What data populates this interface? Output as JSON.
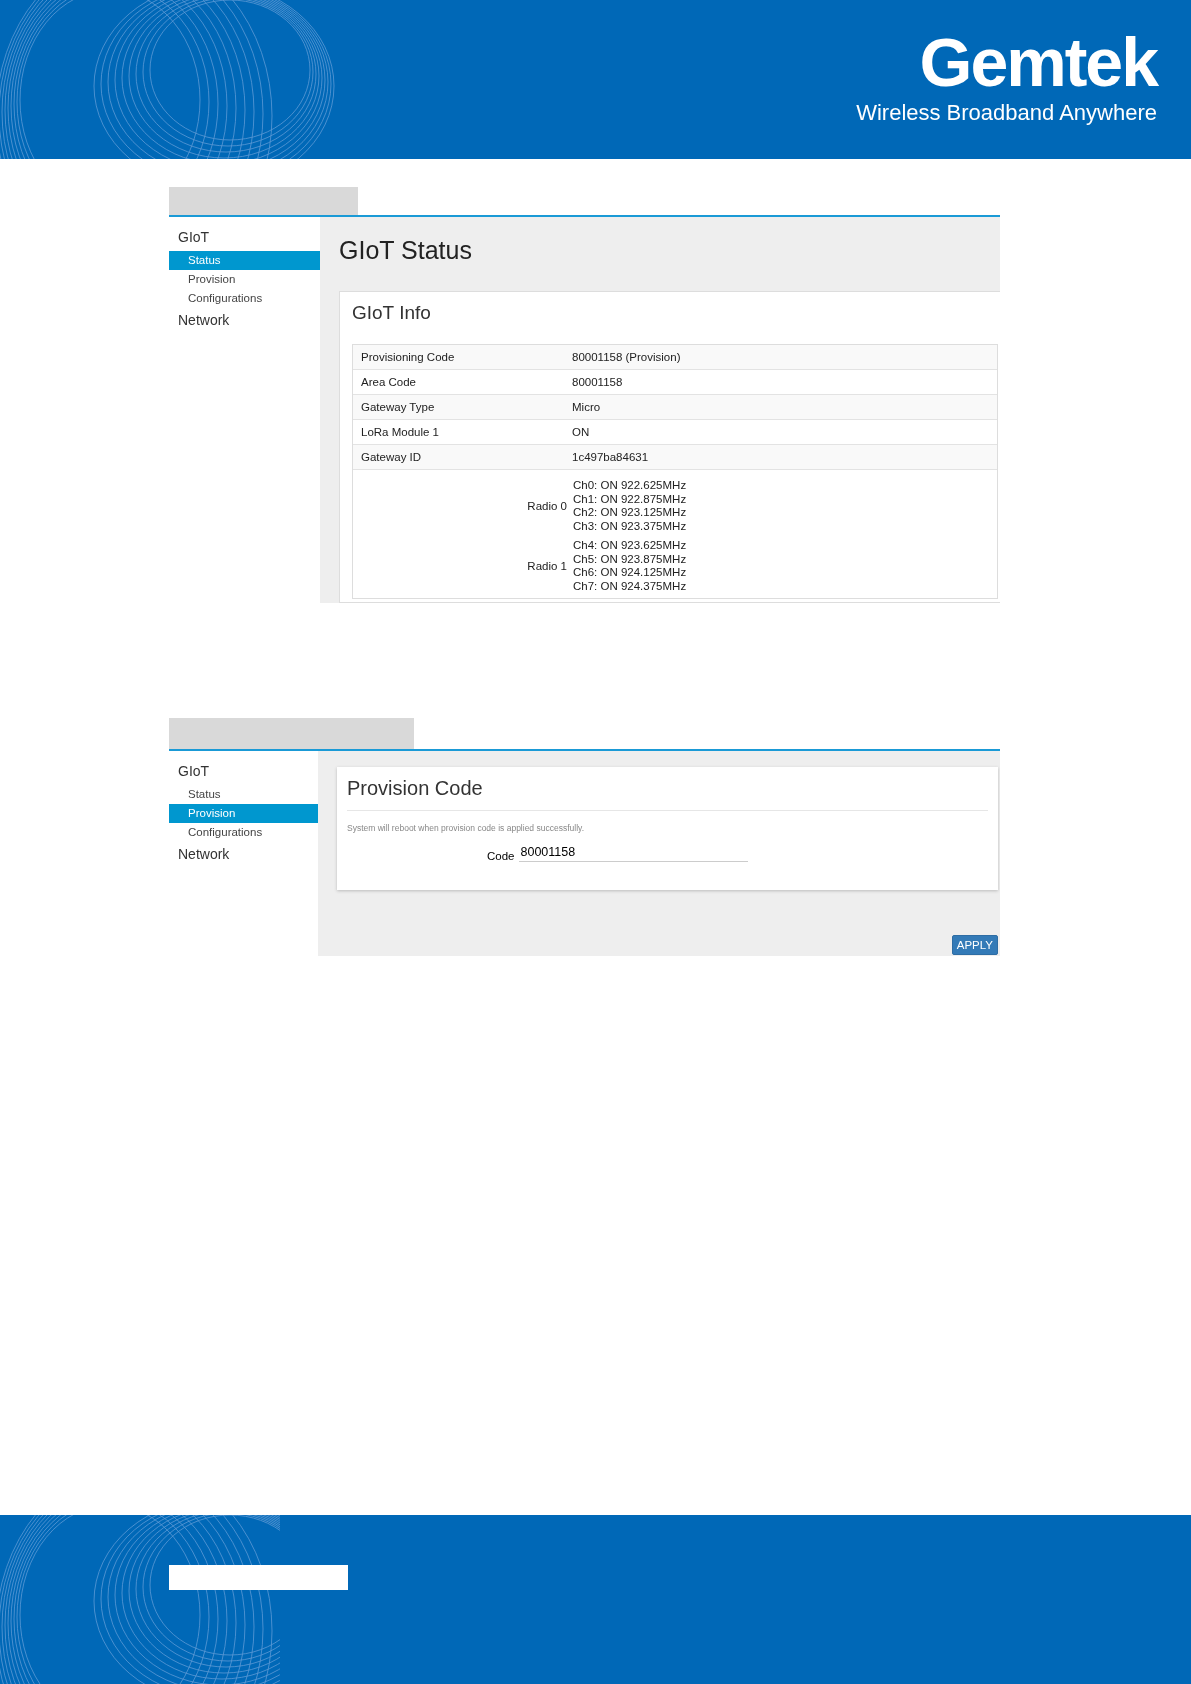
{
  "header": {
    "logo": "Gemtek",
    "tagline": "Wireless Broadband Anywhere"
  },
  "screens": [
    {
      "kind": "status",
      "nav": [
        {
          "label": "GIoT",
          "children": [
            {
              "label": "Status",
              "selected": true
            },
            {
              "label": "Provision",
              "selected": false
            },
            {
              "label": "Configurations",
              "selected": false
            }
          ]
        },
        {
          "label": "Network"
        }
      ],
      "title": "GIoT Status",
      "panel_title": "GIoT Info",
      "rows": [
        {
          "label": "Provisioning Code",
          "value": "80001158 (Provision)"
        },
        {
          "label": "Area Code",
          "value": "80001158"
        },
        {
          "label": "Gateway Type",
          "value": "Micro"
        },
        {
          "label": "LoRa Module 1",
          "value": "ON"
        },
        {
          "label": "Gateway ID",
          "value": "1c497ba84631"
        }
      ],
      "radios": [
        {
          "label": "Radio 0",
          "channels": [
            "Ch0: ON 922.625MHz",
            "Ch1: ON 922.875MHz",
            "Ch2: ON 923.125MHz",
            "Ch3: ON 923.375MHz"
          ]
        },
        {
          "label": "Radio 1",
          "channels": [
            "Ch4: ON 923.625MHz",
            "Ch5: ON 923.875MHz",
            "Ch6: ON 924.125MHz",
            "Ch7: ON 924.375MHz"
          ]
        }
      ]
    },
    {
      "kind": "provision",
      "nav": [
        {
          "label": "GIoT",
          "children": [
            {
              "label": "Status",
              "selected": false
            },
            {
              "label": "Provision",
              "selected": true
            },
            {
              "label": "Configurations",
              "selected": false
            }
          ]
        },
        {
          "label": "Network"
        }
      ],
      "panel_title": "Provision Code",
      "note": "System will reboot when provision code is applied successfully.",
      "field": {
        "label": "Code",
        "value": "80001158"
      },
      "button": "APPLY"
    }
  ]
}
